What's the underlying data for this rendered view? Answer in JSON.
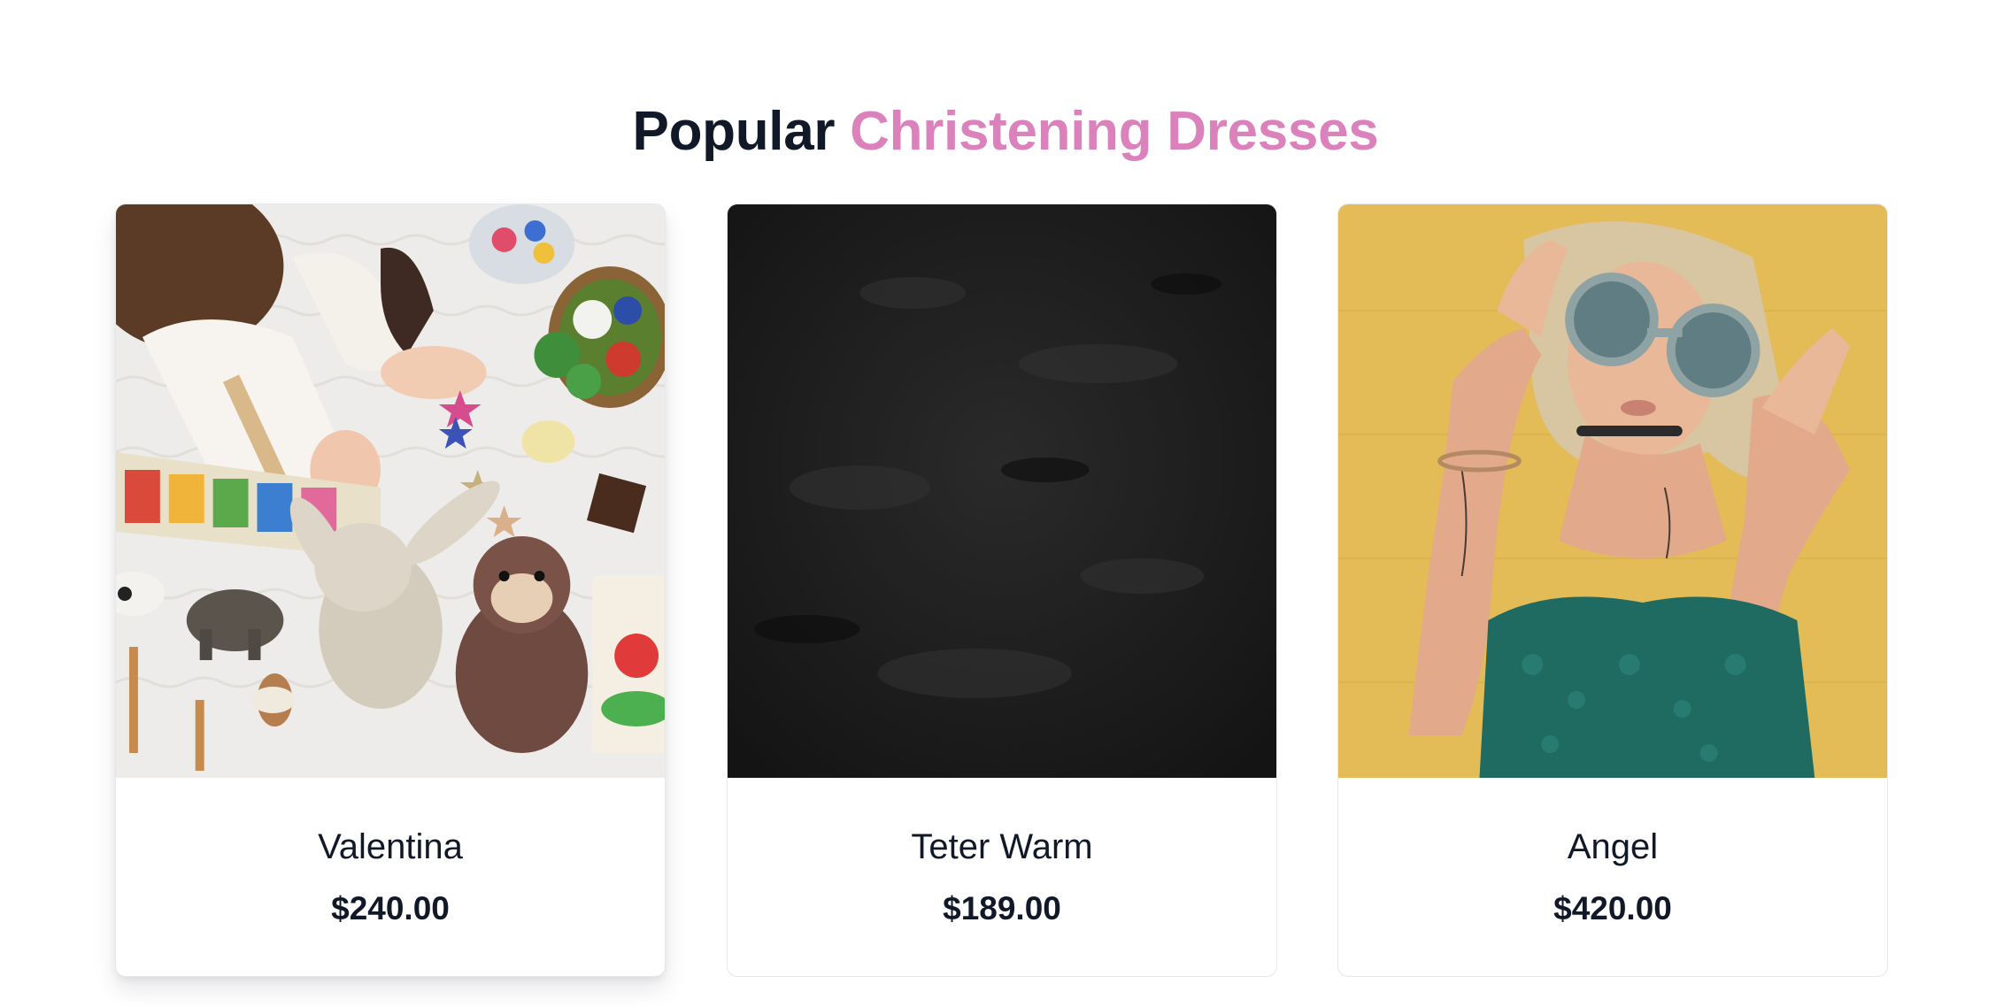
{
  "section": {
    "title_lead": "Popular",
    "title_accent": "Christening Dresses"
  },
  "colors": {
    "accent": "#db82bd",
    "text": "#111827",
    "card_border": "#e5e7eb"
  },
  "products": [
    {
      "name": "Valentina",
      "price": "$240.00",
      "image": "baby-with-toys-photo"
    },
    {
      "name": "Teter Warm",
      "price": "$189.00",
      "image": "dark-texture-photo"
    },
    {
      "name": "Angel",
      "price": "$420.00",
      "image": "woman-with-sunglasses-photo"
    }
  ]
}
